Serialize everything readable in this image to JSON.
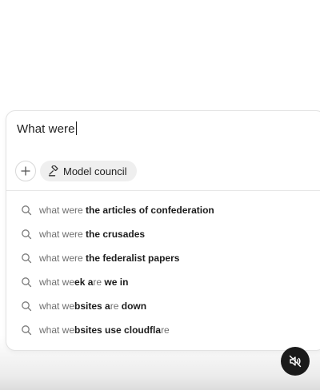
{
  "search": {
    "query": "What were"
  },
  "toolbar": {
    "add_icon": "plus-icon",
    "model_council_label": "Model council",
    "model_council_icon": "gavel-icon"
  },
  "suggestions": [
    {
      "segments": [
        {
          "text": "what were",
          "bold": false
        },
        {
          "text": " the articles of confederation",
          "bold": true
        }
      ]
    },
    {
      "segments": [
        {
          "text": "what were",
          "bold": false
        },
        {
          "text": " the crusades",
          "bold": true
        }
      ]
    },
    {
      "segments": [
        {
          "text": "what were",
          "bold": false
        },
        {
          "text": " the federalist papers",
          "bold": true
        }
      ]
    },
    {
      "segments": [
        {
          "text": "what we",
          "bold": false
        },
        {
          "text": "ek a",
          "bold": true
        },
        {
          "text": "re",
          "bold": false
        },
        {
          "text": " we in",
          "bold": true
        }
      ]
    },
    {
      "segments": [
        {
          "text": "what we",
          "bold": false
        },
        {
          "text": "bsites a",
          "bold": true
        },
        {
          "text": "re",
          "bold": false
        },
        {
          "text": " down",
          "bold": true
        }
      ]
    },
    {
      "segments": [
        {
          "text": "what we",
          "bold": false
        },
        {
          "text": "bsites use cloudfla",
          "bold": true
        },
        {
          "text": "re",
          "bold": false
        }
      ]
    }
  ],
  "media": {
    "mute_icon": "speaker-muted-icon"
  },
  "colors": {
    "panel_border": "#e2e2e2",
    "chip_background": "#efefef",
    "mute_button_background": "#1a1a1a"
  }
}
